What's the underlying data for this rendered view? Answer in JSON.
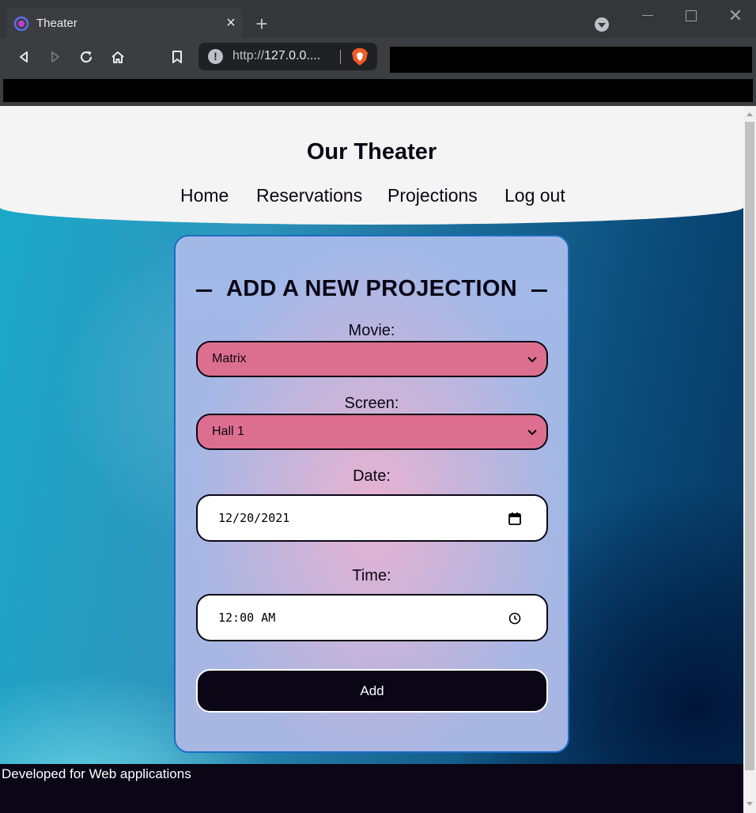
{
  "browser": {
    "tab_title": "Theater",
    "url_scheme": "http://",
    "url_host": "127.0.0...."
  },
  "site": {
    "title": "Our Theater",
    "nav": [
      "Home",
      "Reservations",
      "Projections",
      "Log out"
    ]
  },
  "form": {
    "heading": "ADD A NEW PROJECTION",
    "movie_label": "Movie:",
    "movie_value": "Matrix",
    "screen_label": "Screen:",
    "screen_value": "Hall 1",
    "date_label": "Date:",
    "date_value": "12/20/2021",
    "time_label": "Time:",
    "time_value": "12:00 AM",
    "submit_label": "Add"
  },
  "footer": {
    "text": "Developed for Web applications"
  },
  "colors": {
    "header_bg": "#f4f4f4",
    "select_bg": "#dc6f8f",
    "button_bg": "#0b0616",
    "card_border": "#1c6bc4"
  }
}
